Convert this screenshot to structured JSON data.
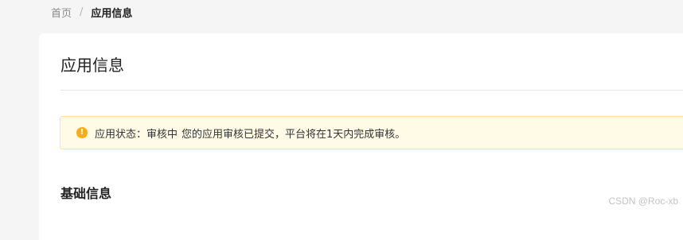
{
  "breadcrumb": {
    "home": "首页",
    "separator": "/",
    "current": "应用信息"
  },
  "page": {
    "title": "应用信息"
  },
  "alert": {
    "icon": "warning-circle-icon",
    "status_label": "应用状态：审核中",
    "message": "您的应用审核已提交，平台将在1天内完成审核。",
    "colors": {
      "background": "#fffbe6",
      "border": "#ffe58f",
      "icon": "#faad14"
    }
  },
  "section": {
    "title": "基础信息"
  },
  "watermark": "CSDN @Roc-xb"
}
